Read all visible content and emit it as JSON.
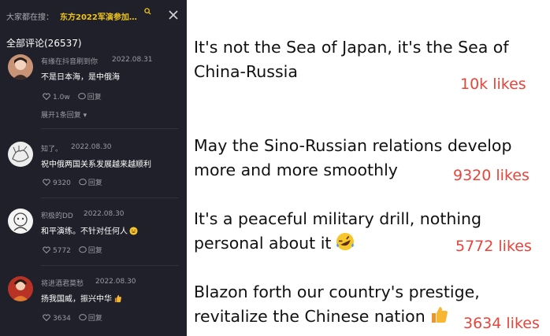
{
  "search": {
    "prefix": "大家都在搜：",
    "term": "东方2022军演参加…"
  },
  "comments_count": "全部评论(26537)",
  "comments": [
    {
      "username": "有缘在抖音刷到你",
      "date": "2022.08.31",
      "text": "不是日本海，是中俄海",
      "likes": "1.0w",
      "reply_label": "回复",
      "expand": "展开1条回复",
      "avatar_color": "#d8a07a"
    },
    {
      "username": "知了。",
      "date": "2022.08.30",
      "text": "祝中俄两国关系发展越来越顺利",
      "likes": "9320",
      "reply_label": "回复",
      "avatar_color": "#e9e9e9"
    },
    {
      "username": "积极的DD",
      "date": "2022.08.30",
      "text": "和平演练。不针对任何人",
      "likes": "5772",
      "reply_label": "回复",
      "avatar_color": "#f2f2f2"
    },
    {
      "username": "将进酒君莫愁",
      "date": "2022.08.30",
      "text": "扬我国威，振兴中华",
      "likes": "3634",
      "reply_label": "回复",
      "avatar_color": "#c63a2e"
    }
  ],
  "translations": [
    {
      "line1": "It's not the Sea of Japan, it's the Sea of",
      "line2": "China-Russia",
      "likes": "10k likes"
    },
    {
      "line1": "May the Sino-Russian relations develop",
      "line2": "more and more smoothly",
      "likes": "9320 likes"
    },
    {
      "line1": "It's a peaceful military drill, nothing",
      "line2": "personal about it",
      "likes": "5772 likes",
      "emoji": "rofl-emoji"
    },
    {
      "line1": "Blazon forth our country's prestige,",
      "line2": "revitalize the Chinese nation",
      "likes": "3634 likes",
      "emoji": "thumbs-up-emoji"
    }
  ],
  "colors": {
    "panel_bg": "#1f2029",
    "search_term": "#f0c419",
    "likes_red": "#e8443a"
  }
}
